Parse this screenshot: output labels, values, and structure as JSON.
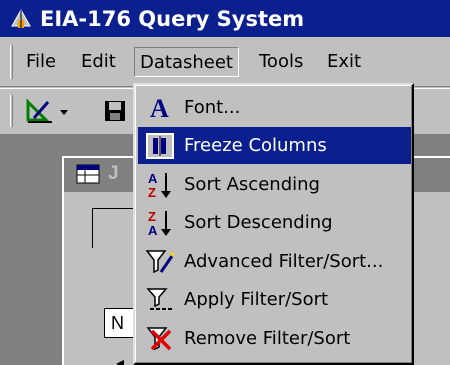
{
  "window": {
    "title": "EIA-176 Query System"
  },
  "menubar": {
    "items": [
      {
        "label": "File"
      },
      {
        "label": "Edit"
      },
      {
        "label": "Datasheet"
      },
      {
        "label": "Tools"
      },
      {
        "label": "Exit"
      }
    ]
  },
  "child_window": {
    "title_fragment": "J",
    "grid_header": "N",
    "row_marker": "◂"
  },
  "datasheet_menu": {
    "items": [
      {
        "label": "Font...",
        "icon": "font-icon"
      },
      {
        "label": "Freeze Columns",
        "icon": "freeze-columns-icon",
        "highlighted": true
      },
      {
        "label": "Sort Ascending",
        "icon": "sort-ascending-icon"
      },
      {
        "label": "Sort Descending",
        "icon": "sort-descending-icon"
      },
      {
        "label": "Advanced Filter/Sort...",
        "icon": "advanced-filter-icon"
      },
      {
        "label": "Apply Filter/Sort",
        "icon": "apply-filter-icon"
      },
      {
        "label": "Remove Filter/Sort",
        "icon": "remove-filter-icon"
      }
    ]
  },
  "colors": {
    "title_bar": "#0b1f8f",
    "menu_highlight": "#0b1f8f",
    "face": "#c0c0c0",
    "workspace": "#808080"
  }
}
